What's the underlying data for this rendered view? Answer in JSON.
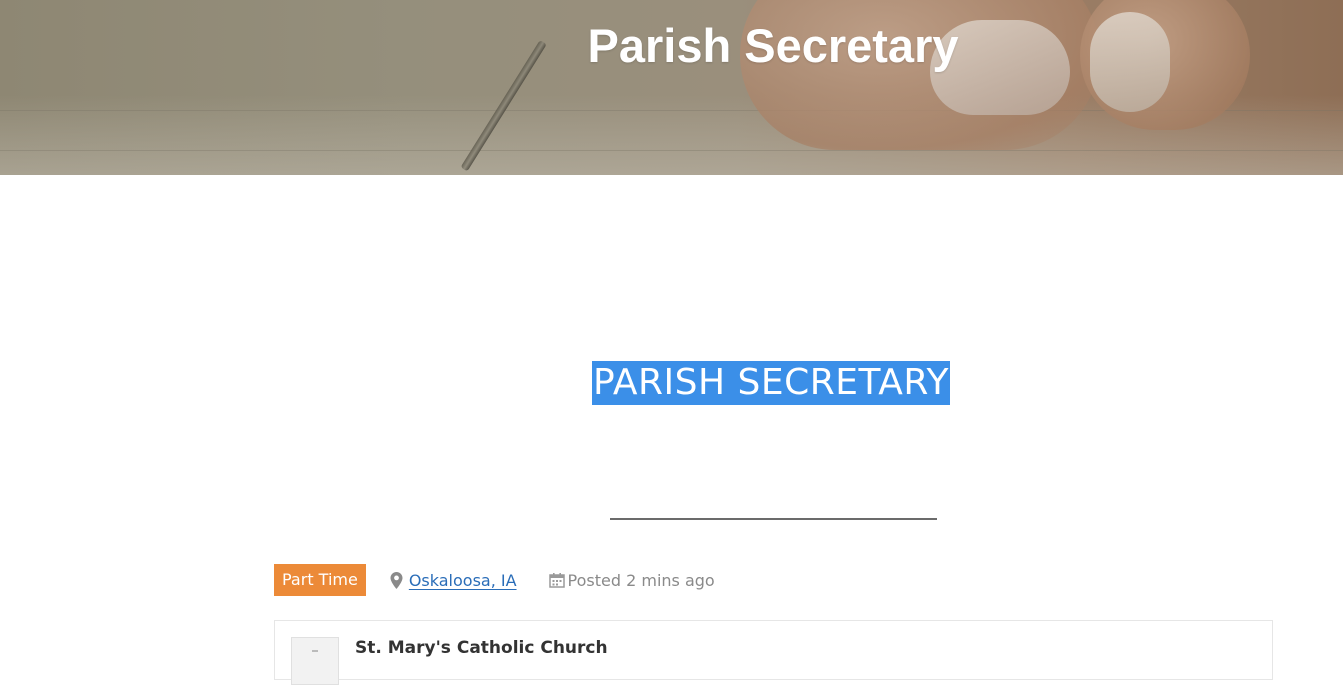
{
  "hero": {
    "title": "Parish Secretary"
  },
  "job": {
    "title": "PARISH SECRETARY",
    "type_badge": "Part Time",
    "location": "Oskaloosa, IA",
    "posted": "Posted 2 mins ago"
  },
  "company": {
    "name": "St. Mary's Catholic Church"
  },
  "colors": {
    "badge": "#ec8a38",
    "selection": "#3b8fe8",
    "link": "#2a6db8"
  },
  "icons": {
    "location": "map-pin-icon",
    "posted": "calendar-icon"
  }
}
